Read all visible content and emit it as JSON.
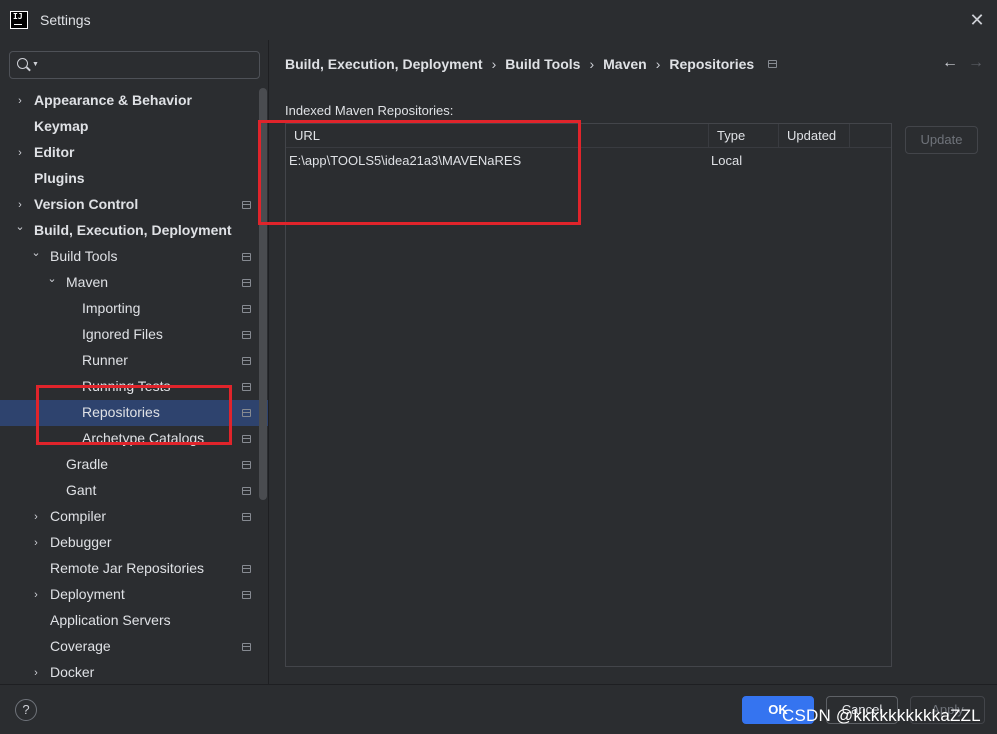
{
  "window": {
    "title": "Settings",
    "app_icon_text": "IJ"
  },
  "search": {
    "placeholder": "",
    "value": ""
  },
  "sidebar": {
    "items": [
      {
        "label": "Appearance & Behavior",
        "bold": true,
        "chevron": "right",
        "project": false
      },
      {
        "label": "Keymap",
        "bold": true,
        "chevron": "none",
        "project": false
      },
      {
        "label": "Editor",
        "bold": true,
        "chevron": "right",
        "project": false
      },
      {
        "label": "Plugins",
        "bold": true,
        "chevron": "none",
        "project": false
      },
      {
        "label": "Version Control",
        "bold": true,
        "chevron": "right",
        "project": true
      },
      {
        "label": "Build, Execution, Deployment",
        "bold": true,
        "chevron": "down",
        "project": false
      },
      {
        "label": "Build Tools",
        "bold": false,
        "chevron": "down",
        "project": true
      },
      {
        "label": "Maven",
        "bold": false,
        "chevron": "down",
        "project": true
      },
      {
        "label": "Importing",
        "bold": false,
        "chevron": "none",
        "project": true
      },
      {
        "label": "Ignored Files",
        "bold": false,
        "chevron": "none",
        "project": true
      },
      {
        "label": "Runner",
        "bold": false,
        "chevron": "none",
        "project": true
      },
      {
        "label": "Running Tests",
        "bold": false,
        "chevron": "none",
        "project": true
      },
      {
        "label": "Repositories",
        "bold": false,
        "chevron": "none",
        "project": true,
        "selected": true
      },
      {
        "label": "Archetype Catalogs",
        "bold": false,
        "chevron": "none",
        "project": true
      },
      {
        "label": "Gradle",
        "bold": false,
        "chevron": "none",
        "project": true
      },
      {
        "label": "Gant",
        "bold": false,
        "chevron": "none",
        "project": true
      },
      {
        "label": "Compiler",
        "bold": false,
        "chevron": "right",
        "project": true
      },
      {
        "label": "Debugger",
        "bold": false,
        "chevron": "right",
        "project": false
      },
      {
        "label": "Remote Jar Repositories",
        "bold": false,
        "chevron": "none",
        "project": true
      },
      {
        "label": "Deployment",
        "bold": false,
        "chevron": "right",
        "project": true
      },
      {
        "label": "Application Servers",
        "bold": false,
        "chevron": "none",
        "project": false
      },
      {
        "label": "Coverage",
        "bold": false,
        "chevron": "none",
        "project": true
      },
      {
        "label": "Docker",
        "bold": false,
        "chevron": "right",
        "project": false
      }
    ]
  },
  "breadcrumb": {
    "items": [
      "Build, Execution, Deployment",
      "Build Tools",
      "Maven",
      "Repositories"
    ],
    "separator": "›"
  },
  "nav": {
    "back": "←",
    "forward": "→"
  },
  "main": {
    "section_label": "Indexed Maven Repositories:",
    "columns": [
      "URL",
      "Type",
      "Updated"
    ],
    "rows": [
      {
        "url": "E:\\app\\TOOLS5\\idea21a3\\MAVENaRES",
        "type": "Local",
        "updated": ""
      }
    ],
    "update_button": "Update"
  },
  "footer": {
    "help": "?",
    "ok": "OK",
    "cancel": "Cancel",
    "apply": "Apply",
    "watermark": "CSDN @kkkkkkkkkkaZZL"
  },
  "colors": {
    "background": "#2b2d30",
    "selected_row": "#2e436e",
    "accent_button": "#3574f0",
    "annotation_red": "#e0242b"
  }
}
